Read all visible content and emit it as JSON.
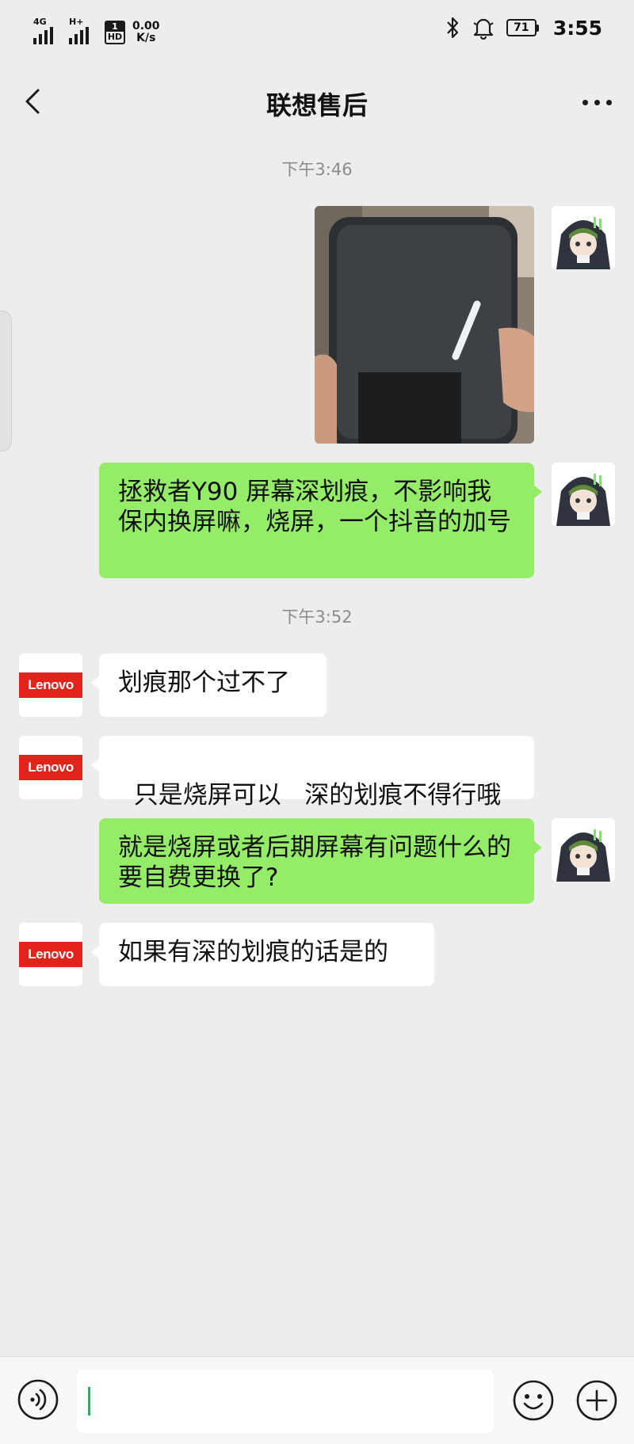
{
  "status_bar": {
    "network_1": "4G",
    "network_2": "H+",
    "hd_top": "1",
    "hd_bottom": "HD",
    "net_speed_value": "0.00",
    "net_speed_unit": "K/s",
    "battery": "71",
    "time": "3:55"
  },
  "nav": {
    "title": "联想售后"
  },
  "chat": {
    "timestamps": [
      "下午3:46",
      "下午3:52"
    ],
    "messages": [
      {
        "sender": "self",
        "type": "image"
      },
      {
        "sender": "self",
        "type": "text",
        "text": "拯救者Y90 屏幕深划痕，不影响我保内换屏嘛，烧屏，一个抖音的加号"
      },
      {
        "sender": "lenovo",
        "type": "text",
        "text": "划痕那个过不了"
      },
      {
        "sender": "lenovo",
        "type": "text",
        "text": "只是烧屏可以   深的划痕不得行哦"
      },
      {
        "sender": "self",
        "type": "text",
        "text": "就是烧屏或者后期屏幕有问题什么的要自费更换了?"
      },
      {
        "sender": "lenovo",
        "type": "text",
        "text": "如果有深的划痕的话是的"
      }
    ],
    "lenovo_avatar_label": "Lenovo"
  },
  "input": {
    "value": ""
  },
  "icons": {
    "back": "back-arrow-icon",
    "more": "more-dots-icon",
    "voice": "voice-icon",
    "emoji": "emoji-icon",
    "plus": "plus-icon",
    "bluetooth": "bluetooth-icon",
    "bell": "bell-icon"
  },
  "colors": {
    "outgoing_bubble": "#95ec69",
    "incoming_bubble": "#ffffff",
    "background": "#ededed",
    "lenovo_red": "#e2231a",
    "caret": "#07c160"
  }
}
